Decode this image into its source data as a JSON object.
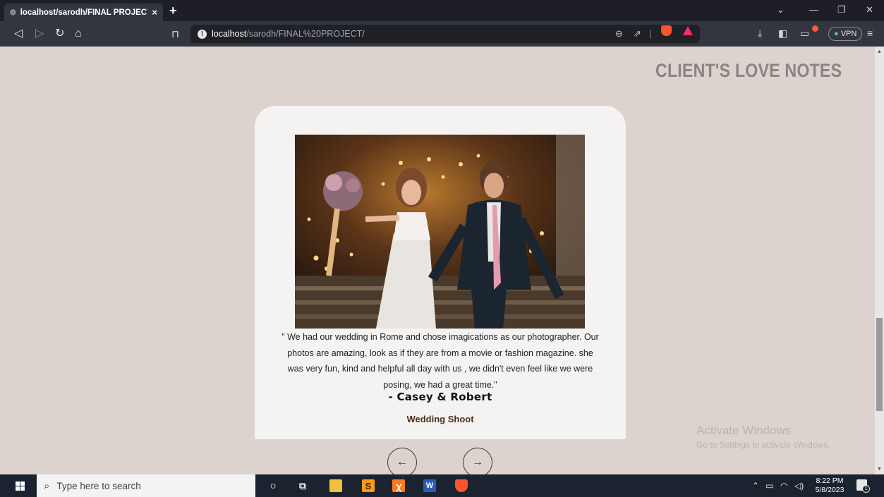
{
  "browser": {
    "tab_title": "localhost/sarodh/FINAL PROJECT/",
    "tab_close": "×",
    "new_tab": "+",
    "url_host": "localhost",
    "url_path": "/sarodh/FINAL%20PROJECT/",
    "vpn_label": "VPN"
  },
  "page": {
    "section_heading": "CLIENT'S LOVE NOTES",
    "testimonial": {
      "quote": "\" We had our wedding in Rome and chose imagications as our photographer. Our photos are amazing, look as if they are from a movie or fashion magazine. she was very fun, kind and helpful all day with us , we didn't even feel like we were posing, we had a great time.\"",
      "client": "- Casey & Robert",
      "shoot_type": "Wedding Shoot"
    },
    "prev_arrow": "←",
    "next_arrow": "→"
  },
  "watermark": {
    "title": "Activate Windows",
    "subtitle": "Go to Settings to activate Windows."
  },
  "taskbar": {
    "search_placeholder": "Type here to search",
    "time": "8:22 PM",
    "date": "5/8/2023",
    "notification_count": "1"
  },
  "icons": {
    "brave": "brave-lion-icon",
    "rewards": "brave-rewards-icon"
  },
  "colors": {
    "page_background": "#dcd3cf",
    "card_background": "#f4f3f2",
    "heading": "#8a8482",
    "shoot_type": "#4a2f1f",
    "brave_orange": "#fb542b"
  }
}
